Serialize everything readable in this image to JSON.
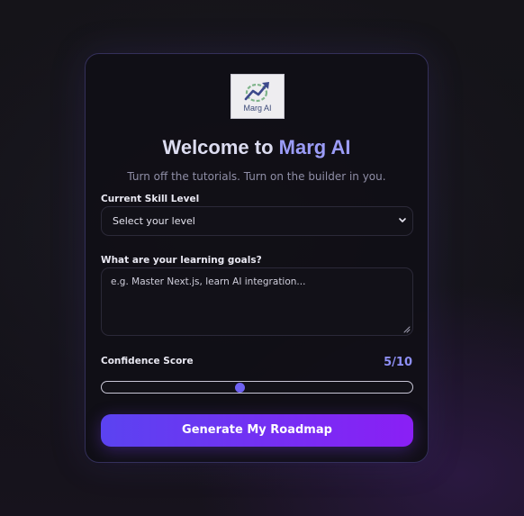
{
  "brand": {
    "logo_text": "Marg AI",
    "title_prefix": "Welcome to ",
    "title_accent": "Marg AI",
    "tagline": "Turn off the tutorials. Turn on the builder in you."
  },
  "form": {
    "skill_level": {
      "label": "Current Skill Level",
      "selected": "Select your level"
    },
    "goals": {
      "label": "What are your learning goals?",
      "placeholder": "e.g. Master Next.js, learn AI integration..."
    },
    "confidence": {
      "label": "Confidence Score",
      "value_text": "5/10",
      "value": 5,
      "min": 1,
      "max": 10
    },
    "submit_label": "Generate My Roadmap"
  },
  "icons": {
    "logo": "rising-chart-arrow-icon",
    "select": "chevron-down-icon",
    "textarea": "resize-grip-icon"
  },
  "colors": {
    "accent": "#9b9cf7",
    "score": "#8e8ff5",
    "button_start": "#5b43f1",
    "button_end": "#8a1ff5",
    "slider_thumb": "#6f62f2"
  }
}
